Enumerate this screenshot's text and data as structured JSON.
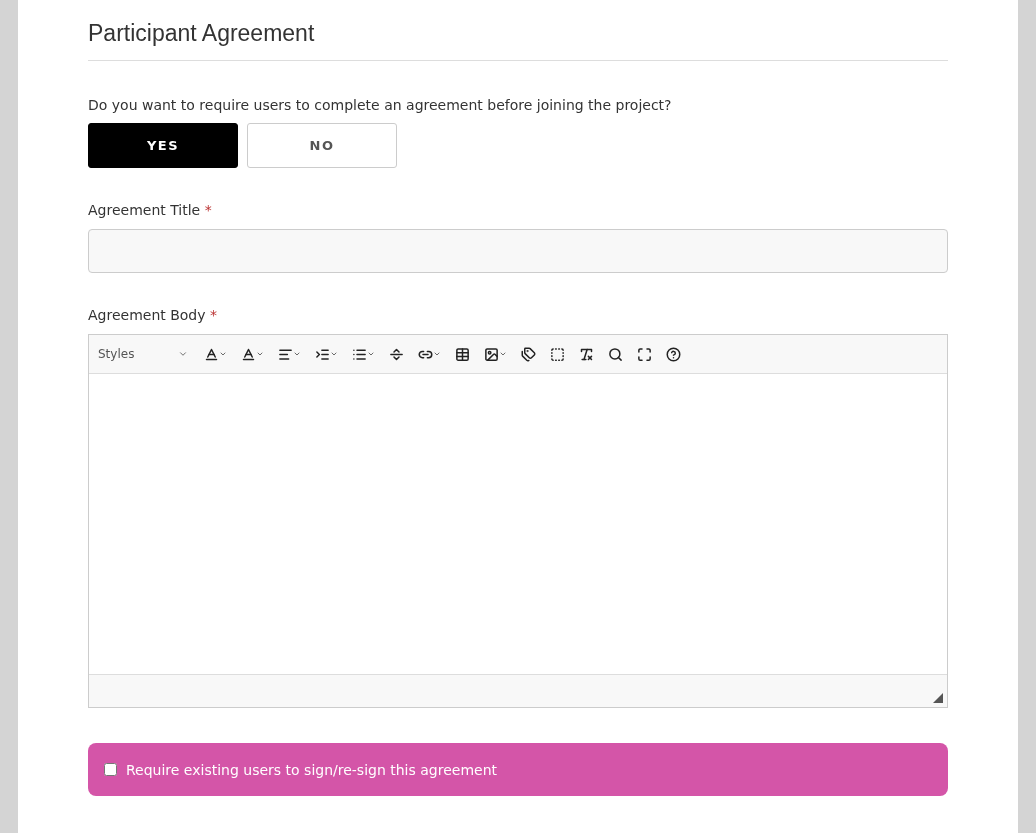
{
  "section_title": "Participant Agreement",
  "question": "Do you want to require users to complete an agreement before joining the project?",
  "choices": [
    {
      "label": "YES",
      "selected": true
    },
    {
      "label": "NO",
      "selected": false
    }
  ],
  "title_field": {
    "label": "Agreement Title",
    "required_mark": "*"
  },
  "body_field": {
    "label": "Agreement Body",
    "required_mark": "*",
    "styles_dropdown": "Styles"
  },
  "resign_option": {
    "label": "Require existing users to sign/re-sign this agreement",
    "checked": false
  }
}
